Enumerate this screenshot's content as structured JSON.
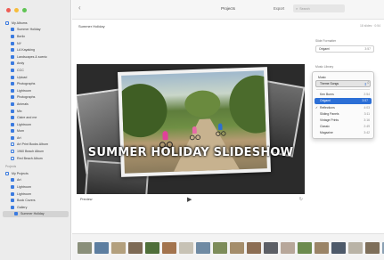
{
  "window": {
    "title": "Projects",
    "export_label": "Export",
    "search_placeholder": "Search",
    "back_glyph": "‹"
  },
  "sidebar": {
    "items": [
      {
        "label": "My Albums",
        "level": 0,
        "icon": "folder-icon"
      },
      {
        "label": "Summer Holiday",
        "level": 1,
        "icon": "album-icon"
      },
      {
        "label": "Berlin",
        "level": 1,
        "icon": "album-icon"
      },
      {
        "label": "NY",
        "level": 1,
        "icon": "album-icon"
      },
      {
        "label": "LA Kayaking",
        "level": 1,
        "icon": "album-icon"
      },
      {
        "label": "Landscapes & scenic",
        "level": 1,
        "icon": "album-icon"
      },
      {
        "label": "Andy",
        "level": 1,
        "icon": "album-icon"
      },
      {
        "label": "CCC",
        "level": 1,
        "icon": "album-icon"
      },
      {
        "label": "Upload",
        "level": 1,
        "icon": "album-icon"
      },
      {
        "label": "Photographs",
        "level": 1,
        "icon": "album-icon"
      },
      {
        "label": "Lightroom",
        "level": 1,
        "icon": "album-icon"
      },
      {
        "label": "Photographs",
        "level": 1,
        "icon": "album-icon"
      },
      {
        "label": "Animals",
        "level": 1,
        "icon": "album-icon"
      },
      {
        "label": "Mix",
        "level": 1,
        "icon": "album-icon"
      },
      {
        "label": "Claire and me",
        "level": 1,
        "icon": "album-icon"
      },
      {
        "label": "Lightroom",
        "level": 1,
        "icon": "album-icon"
      },
      {
        "label": "Mom",
        "level": 1,
        "icon": "album-icon"
      },
      {
        "label": "Art",
        "level": 1,
        "icon": "album-icon"
      },
      {
        "label": "Art Print Books Album",
        "level": 1,
        "icon": "smart-album-icon"
      },
      {
        "label": "1960 Beach Album",
        "level": 1,
        "icon": "smart-album-icon"
      },
      {
        "label": "Red Beach Album",
        "level": 1,
        "icon": "smart-album-icon"
      },
      {
        "label": "Projects",
        "level": 0,
        "icon": "header",
        "header": true
      },
      {
        "label": "My Projects",
        "level": 0,
        "icon": "folder-icon"
      },
      {
        "label": "Art",
        "level": 1,
        "icon": "project-icon"
      },
      {
        "label": "Lightroom",
        "level": 1,
        "icon": "project-icon"
      },
      {
        "label": "Lightroom",
        "level": 1,
        "icon": "project-icon"
      },
      {
        "label": "Book Covers",
        "level": 1,
        "icon": "project-icon"
      },
      {
        "label": "Gallery",
        "level": 1,
        "icon": "project-icon"
      },
      {
        "label": "Summer Holiday",
        "level": 1,
        "icon": "project-icon",
        "selected": true
      }
    ]
  },
  "project": {
    "name": "Summer Holiday",
    "info": "18 slides · 0:54"
  },
  "slide": {
    "title": "SUMMER HOLIDAY SLIDESHOW"
  },
  "playback": {
    "preview_label": "Preview",
    "play_glyph": "▶",
    "loop_glyph": "↻"
  },
  "right_panel": {
    "format_label": "Slide Formatter",
    "format_value": "Origami",
    "format_duration": "3:57",
    "music_label": "Music Library"
  },
  "music_menu": {
    "top_label": "Theme Songs",
    "head_label": "Music",
    "items": [
      {
        "name": "Ken Burns",
        "time": "2:54"
      },
      {
        "name": "Origami",
        "time": "3:57",
        "highlighted": true
      },
      {
        "name": "Reflections",
        "time": "4:03",
        "checked": true
      },
      {
        "name": "Sliding Panels",
        "time": "3:11"
      },
      {
        "name": "Vintage Prints",
        "time": "3:16"
      },
      {
        "name": "Classic",
        "time": "2:49"
      },
      {
        "name": "Magazine",
        "time": "3:42"
      }
    ]
  },
  "filmstrip": {
    "thumb_colors": [
      "#8a8f7a",
      "#5d7ea0",
      "#b3a07e",
      "#7d6a55",
      "#4f6f3a",
      "#a3744e",
      "#c7c2b5",
      "#6f8aa3",
      "#7d8c5a",
      "#a48d6b",
      "#8c6e54",
      "#5c5f66",
      "#b7a79a",
      "#6c8b4e",
      "#9a8467",
      "#4e5a6a",
      "#b9b3a6",
      "#7e6f5a",
      "#8aa0b3",
      "#63703f"
    ]
  }
}
